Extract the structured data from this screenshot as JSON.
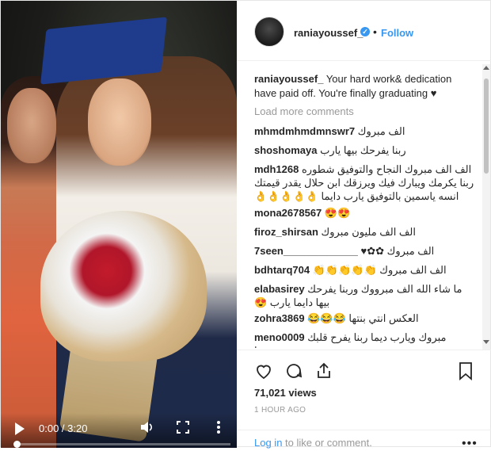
{
  "video": {
    "time": "0:00 / 3:20",
    "progress_fraction": 0.0
  },
  "header": {
    "username": "raniayoussef_",
    "follow_label": "Follow",
    "separator": "•"
  },
  "caption": {
    "username": "raniayoussef_",
    "text": "Your hard work& dedication have paid off. You're finally graduating ♥"
  },
  "load_more_label": "Load more comments",
  "comments": [
    {
      "user": "mhmdmhmdmnswr7",
      "text": "الف مبروك"
    },
    {
      "user": "shoshomaya",
      "text": "ربنا يفرحك بيها يارب"
    },
    {
      "user": "mdh1268",
      "text": "الف الف مبروك النجاح والتوفيق شطوره ربنا يكرمك ويبارك فيك ويرزقك ابن حلال يقدر قيمتك انسه ياسمين بالتوفيق يارب دايما 👌👌👌👌👌"
    },
    {
      "user": "mona2678567",
      "text": "😍😍"
    },
    {
      "user": "firoz_shirsan",
      "text": "الف الف مليون مبروك"
    },
    {
      "user": "7seen_____________",
      "text": "الف مبروك ✿✿♥"
    },
    {
      "user": "bdhtarq704",
      "text": "الف الف مبروك 👏👏👏👏👏"
    },
    {
      "user": "elabasirey",
      "text": "ما شاء الله الف مبرووك وربنا يفرحك بيها دايما يارب 😍"
    },
    {
      "user": "zohra3869",
      "text": "العكس انتي بنتها 😂😂😂"
    },
    {
      "user": "meno0009",
      "text": "مبروك ويارب ديما ربنا يفرح قلبك ويحميها"
    }
  ],
  "stats": {
    "views": "71,021 views",
    "time_ago": "1 HOUR AGO"
  },
  "login": {
    "link": "Log in",
    "rest": " to like or comment."
  },
  "icons": {
    "like": "heart-icon",
    "comment": "comment-icon",
    "share": "share-icon",
    "save": "bookmark-icon",
    "options": "more-options-icon"
  },
  "colors": {
    "accent": "#3897f0",
    "text": "#262626",
    "muted": "#999999"
  }
}
